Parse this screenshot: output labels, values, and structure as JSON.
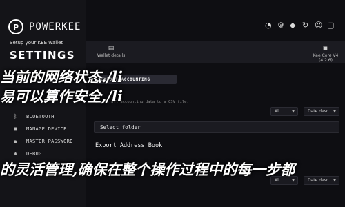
{
  "app": {
    "brand": "POWERKEE",
    "setup_text": "Setup your KEE wallet",
    "settings_title": "SETTINGS"
  },
  "sidebar": {
    "items": [
      {
        "label": "BLUETOOTH",
        "icon": "bluetooth-icon"
      },
      {
        "label": "MANAGE DEVICE",
        "icon": "device-icon"
      },
      {
        "label": "MASTER PASSWORD",
        "icon": "lock-icon"
      },
      {
        "label": "DEBUG",
        "icon": "debug-icon"
      }
    ]
  },
  "devices": {
    "tabs": [
      {
        "label": "Wallet details",
        "icon": "wallet-icon"
      },
      {
        "label": "Kee Core V4 (4.2.6)",
        "icon": "device-icon"
      }
    ]
  },
  "content": {
    "export_button": "EXPORT ACCOUNTING",
    "export_description": "Export all accounting data to a CSV file.",
    "filter_all": "All",
    "filter_date": "Date desc",
    "select_folder": "Select folder",
    "export_address_title": "Export Address Book"
  },
  "overlay": {
    "line1": "当前的网络状态./li",
    "line2": "易可以算作安全,/li",
    "line3": "的灵活管理,确保在整个操作过程中的每一步都"
  },
  "colors": {
    "background": "#0e0e12",
    "sidebar": "#141418",
    "accent_button": "#2a2a33"
  }
}
